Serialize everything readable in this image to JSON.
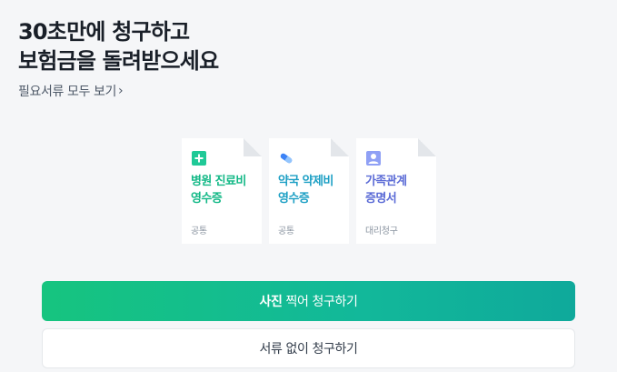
{
  "headline": {
    "line1": "30초만에 청구하고",
    "line2": "보험금을 돌려받으세요"
  },
  "docs_link": {
    "label": "필요서류 모두 보기",
    "chevron": "›"
  },
  "cards": [
    {
      "icon": "plus-square-icon",
      "title_line1": "병원 진료비",
      "title_line2": "영수증",
      "tag": "공통",
      "color": "#12b886",
      "icon_color": "#20c997"
    },
    {
      "icon": "pill-icon",
      "title_line1": "약국 약제비",
      "title_line2": "영수증",
      "tag": "공통",
      "color": "#1c9fc4",
      "icon_color": "#3b82f6"
    },
    {
      "icon": "person-id-icon",
      "title_line1": "가족관계",
      "title_line2": "증명서",
      "tag": "대리청구",
      "color": "#5b6bd6",
      "icon_color": "#7b8ef0"
    }
  ],
  "buttons": {
    "primary_bold": "사진",
    "primary_rest": " 찍어 청구하기",
    "secondary": "서류 없이 청구하기"
  }
}
